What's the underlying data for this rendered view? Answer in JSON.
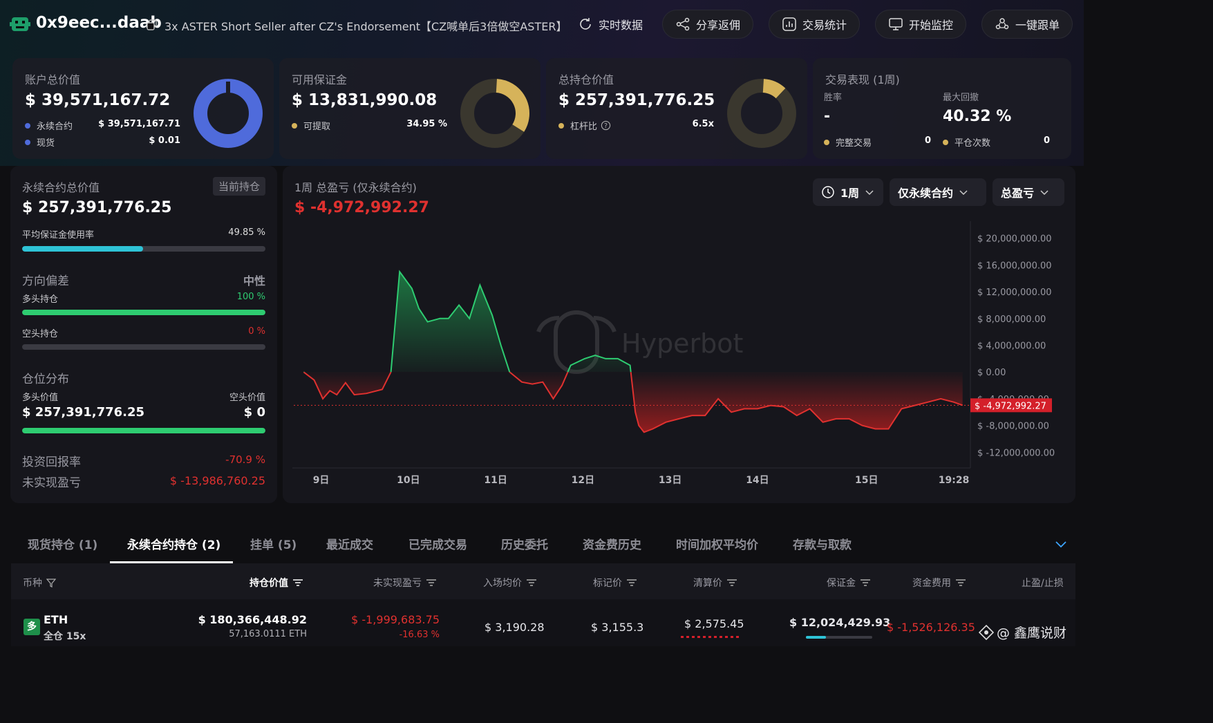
{
  "header": {
    "address": "0x9eec...daab",
    "trader_title": "3x ASTER Short Seller after CZ's Endorsement【CZ喊单后3倍做空ASTER】",
    "buttons": {
      "realtime": "实时数据",
      "share": "分享返佣",
      "stats": "交易统计",
      "monitor": "开始监控",
      "copy_trade": "一键跟单"
    }
  },
  "cards": {
    "account": {
      "label": "账户总价值",
      "value": "$ 39,571,167.72",
      "rows": [
        {
          "label": "永续合约",
          "value": "$ 39,571,167.71"
        },
        {
          "label": "现货",
          "value": "$ 0.01"
        }
      ],
      "perp_share": 1.0
    },
    "margin": {
      "label": "可用保证金",
      "value": "$ 13,831,990.08",
      "row_label": "可提取",
      "row_value": "34.95 %",
      "fraction": 0.3495
    },
    "position": {
      "label": "总持仓价值",
      "value": "$ 257,391,776.25",
      "row_label": "杠杆比",
      "row_value": "6.5x",
      "fraction": 0.13
    },
    "performance": {
      "label": "交易表现 (1周)",
      "winrate_label": "胜率",
      "winrate_value": "-",
      "drawdown_label": "最大回撤",
      "drawdown_value": "40.32 %",
      "completed_label": "完整交易",
      "completed_value": "0",
      "closes_label": "平仓次数",
      "closes_value": "0"
    }
  },
  "left_panel": {
    "title": "永续合约总价值",
    "badge": "当前持仓",
    "value": "$ 257,391,776.25",
    "margin_usage_label": "平均保证金使用率",
    "margin_usage_value": "49.85 %",
    "margin_usage_fraction": 0.4985,
    "bias_label": "方向偏差",
    "bias_value": "中性",
    "long_label": "多头持仓",
    "long_value": "100 %",
    "long_fraction": 1.0,
    "short_label": "空头持仓",
    "short_value": "0 %",
    "short_fraction": 0.0,
    "dist_label": "仓位分布",
    "long_value_label": "多头价值",
    "short_value_label": "空头价值",
    "long_amount": "$ 257,391,776.25",
    "short_amount": "$ 0",
    "long_dist_fraction": 1.0,
    "roi_label": "投资回报率",
    "roi_value": "-70.9 %",
    "upnl_label": "未实现盈亏",
    "upnl_value": "$ -13,986,760.25"
  },
  "chart_panel": {
    "title": "1周 总盈亏 (仅永续合约)",
    "value": "$ -4,972,992.27",
    "filters": {
      "period": "1周",
      "scope": "仅永续合约",
      "metric": "总盈亏"
    },
    "watermark": "Hyperbot"
  },
  "chart_data": {
    "type": "area",
    "title": "1周 总盈亏 (仅永续合约)",
    "y_ticks": [
      "$ 20,000,000.00",
      "$ 16,000,000.00",
      "$ 12,000,000.00",
      "$ 8,000,000.00",
      "$ 4,000,000.00",
      "$ 0.00",
      "$ -4,000,000.00",
      "$ -8,000,000.00",
      "$ -12,000,000.00"
    ],
    "y_tick_values": [
      20000000,
      16000000,
      12000000,
      8000000,
      4000000,
      0,
      -4000000,
      -8000000,
      -12000000
    ],
    "x_ticks": [
      "9日",
      "10日",
      "11日",
      "12日",
      "13日",
      "14日",
      "15日",
      "19:28"
    ],
    "x_tick_positions": [
      0.5,
      1.5,
      2.5,
      3.5,
      4.5,
      5.5,
      6.75,
      7.75
    ],
    "ylim": [
      -13000000,
      21000000
    ],
    "xlim": [
      0.25,
      7.9
    ],
    "reference_value": -4972992.27,
    "reference_label": "$ -4,972,992.27",
    "x": [
      0.3,
      0.42,
      0.52,
      0.6,
      0.68,
      0.78,
      0.88,
      1.02,
      1.2,
      1.3,
      1.4,
      1.54,
      1.62,
      1.72,
      1.86,
      1.96,
      2.08,
      2.2,
      2.32,
      2.46,
      2.56,
      2.66,
      2.8,
      2.92,
      3.04,
      3.16,
      3.26,
      3.36,
      3.52,
      3.64,
      3.76,
      3.9,
      4.04,
      4.1,
      4.14,
      4.2,
      4.3,
      4.45,
      4.6,
      4.75,
      4.9,
      5.05,
      5.2,
      5.35,
      5.5,
      5.65,
      5.8,
      5.95,
      6.1,
      6.25,
      6.4,
      6.55,
      6.7,
      6.85,
      7.0,
      7.15,
      7.3,
      7.45,
      7.6,
      7.75,
      7.85
    ],
    "values": [
      0,
      -1200000,
      -4000000,
      -2800000,
      -3400000,
      -1600000,
      -3400000,
      -3200000,
      -2600000,
      0,
      15000000,
      12500000,
      9500000,
      7500000,
      8000000,
      8000000,
      10000000,
      8000000,
      13000000,
      8500000,
      4000000,
      0,
      -1500000,
      -1800000,
      -1500000,
      -4000000,
      -2000000,
      1000000,
      2000000,
      2500000,
      2000000,
      2000000,
      1000000,
      -6000000,
      -8000000,
      -9000000,
      -8500000,
      -7500000,
      -7000000,
      -6500000,
      -6500000,
      -4000000,
      -6000000,
      -5500000,
      -5500000,
      -5000000,
      -5200000,
      -6500000,
      -5500000,
      -7500000,
      -7000000,
      -7000000,
      -8000000,
      -8500000,
      -8500000,
      -5500000,
      -5000000,
      -4500000,
      -4000000,
      -4500000,
      -4972992.27
    ]
  },
  "tabs": {
    "items": [
      "现货持仓 (1)",
      "永续合约持仓 (2)",
      "挂单 (5)",
      "最近成交",
      "已完成交易",
      "历史委托",
      "资金费历史",
      "时间加权平均价",
      "存款与取款"
    ],
    "active_index": 1
  },
  "table": {
    "headers": [
      "币种",
      "持仓价值",
      "未实现盈亏",
      "入场均价",
      "标记价",
      "清算价",
      "保证金",
      "资金费用",
      "止盈/止损"
    ],
    "row": {
      "side": "多",
      "coin": "ETH",
      "mode": "全仓 15x",
      "value": "$ 180,366,448.92",
      "size": "57,163.0111 ETH",
      "upnl": "$ -1,999,683.75",
      "upnl_pct": "-16.63 %",
      "entry": "$ 3,190.28",
      "mark": "$ 3,155.3",
      "liq": "$ 2,575.45",
      "margin": "$ 12,024,429.93",
      "funding": "$ -1,526,126.35"
    }
  },
  "watermark_bottom": "@ 鑫鹰说财",
  "colors": {
    "green": "#2ecc71",
    "red": "#e0312f",
    "blue": "#4f6bdb",
    "gold": "#d6b35a",
    "cyan": "#2ec3d6"
  }
}
